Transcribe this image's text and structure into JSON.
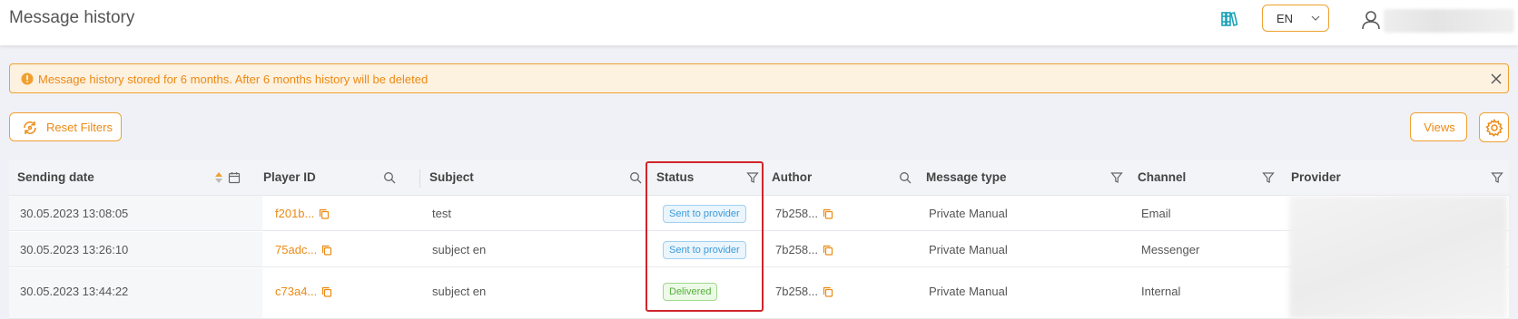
{
  "header": {
    "title": "Message history",
    "language": "EN",
    "icons": {
      "docs": "books-icon",
      "user": "user-icon",
      "lang": "chevron-down-icon"
    }
  },
  "alert": {
    "text": "Message history stored for 6 months. After 6 months history will be deleted",
    "icons": {
      "info": "info-icon",
      "close": "close-icon"
    }
  },
  "toolbar": {
    "reset_label": "Reset Filters",
    "views_label": "Views",
    "icons": {
      "reset": "reset-icon",
      "settings": "gear-icon"
    }
  },
  "colors": {
    "accent": "#ec8a14",
    "badge_blue": "#3d9ad8",
    "badge_green": "#52b03a",
    "highlight": "#d0242b"
  },
  "table": {
    "columns": [
      {
        "label": "Sending date",
        "icons": [
          "sort-icon",
          "calendar-icon"
        ]
      },
      {
        "label": "Player ID",
        "icons": [
          "search-icon"
        ]
      },
      {
        "label": "Subject",
        "icons": [
          "search-icon"
        ]
      },
      {
        "label": "Status",
        "icons": [
          "filter-icon"
        ]
      },
      {
        "label": "Author",
        "icons": [
          "search-icon"
        ]
      },
      {
        "label": "Message type",
        "icons": [
          "filter-icon"
        ]
      },
      {
        "label": "Channel",
        "icons": [
          "filter-icon"
        ]
      },
      {
        "label": "Provider",
        "icons": [
          "filter-icon"
        ]
      }
    ],
    "rows": [
      {
        "date": "30.05.2023 13:08:05",
        "player_id": "f201b...",
        "subject": "test",
        "status": "Sent to provider",
        "status_kind": "blue",
        "author": "7b258...",
        "message_type": "Private Manual",
        "channel": "Email"
      },
      {
        "date": "30.05.2023 13:26:10",
        "player_id": "75adc...",
        "subject": "subject en",
        "status": "Sent to provider",
        "status_kind": "blue",
        "author": "7b258...",
        "message_type": "Private Manual",
        "channel": "Messenger"
      },
      {
        "date": "30.05.2023 13:44:22",
        "player_id": "c73a4...",
        "subject": "subject en",
        "status": "Delivered",
        "status_kind": "green",
        "author": "7b258...",
        "message_type": "Private Manual",
        "channel": "Internal"
      }
    ]
  }
}
